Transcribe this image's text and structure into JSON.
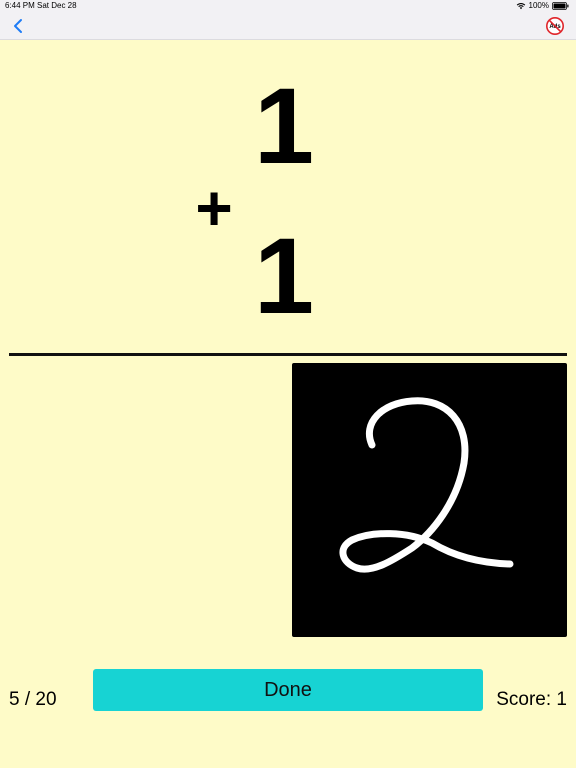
{
  "status_bar": {
    "time": "6:44 PM",
    "date": "Sat Dec 28",
    "battery": "100%",
    "wifi_icon": "wifi-icon",
    "battery_icon": "battery-icon"
  },
  "nav": {
    "back_icon": "chevron-left-icon",
    "no_ads_icon": "no-ads-icon",
    "no_ads_text": "Ads",
    "accent_color": "#1E7CF6",
    "no_ads_color": "#E0262B"
  },
  "problem": {
    "top_number": "1",
    "operator": "+",
    "bottom_number": "1"
  },
  "answer_pad": {
    "handwritten_answer": "2",
    "background_color": "#000000",
    "stroke_color": "#FFFFFF"
  },
  "footer": {
    "progress": "5 / 20",
    "done_label": "Done",
    "score": "Score: 1",
    "done_color": "#17D3D3"
  },
  "colors": {
    "background": "#FEFBC8",
    "bar": "#F2F1F4"
  }
}
